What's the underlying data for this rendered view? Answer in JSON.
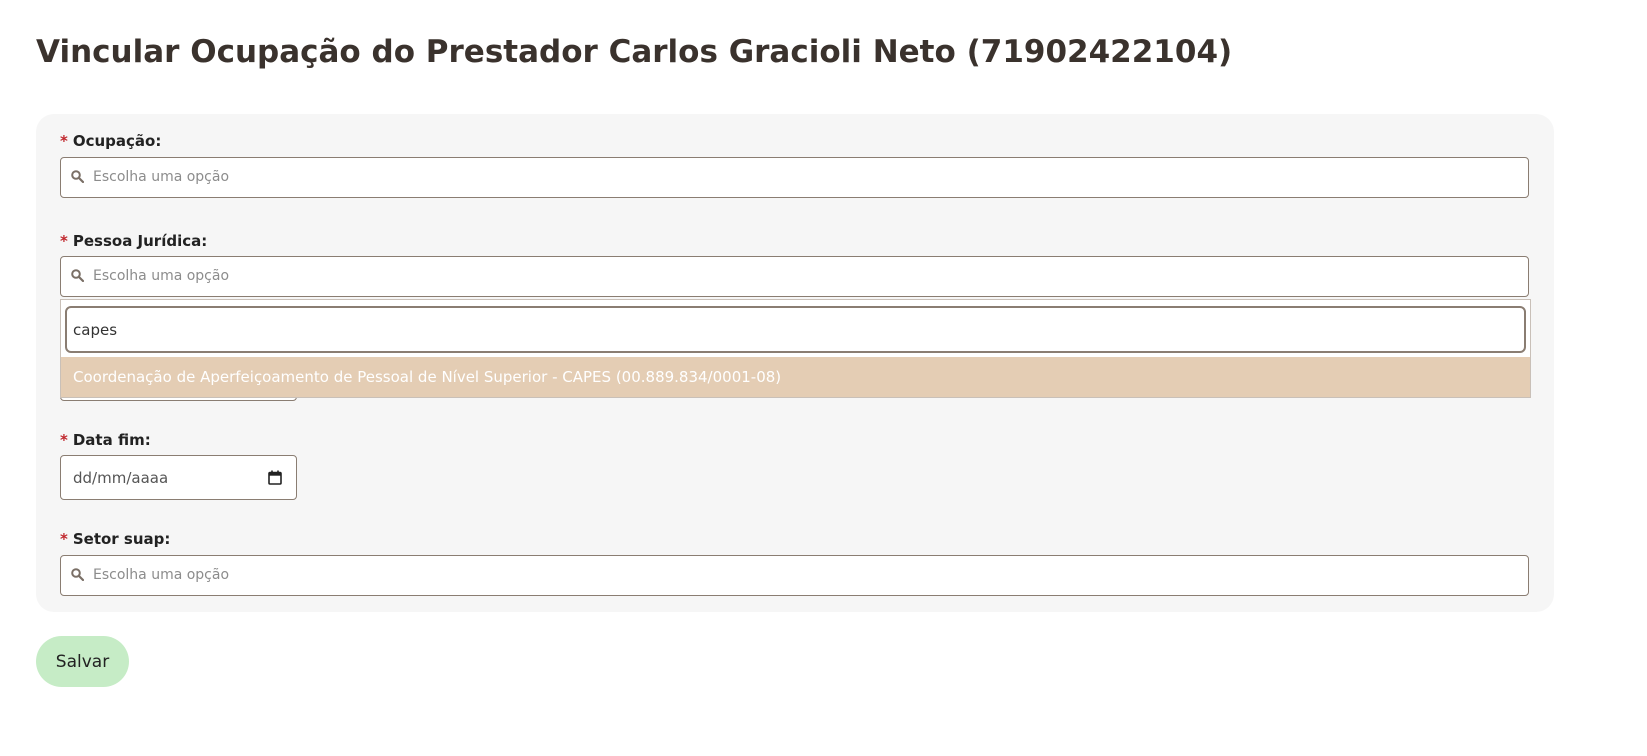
{
  "page": {
    "title": "Vincular Ocupação do Prestador Carlos Gracioli Neto (71902422104)"
  },
  "form": {
    "required_marker": "*",
    "ocupacao": {
      "label": "Ocupação:",
      "placeholder": "Escolha uma opção"
    },
    "pessoa_juridica": {
      "label": "Pessoa Jurídica:",
      "placeholder": "Escolha uma opção",
      "search_value": "capes",
      "options": [
        "Coordenação de Aperfeiçoamento de Pessoal de Nível Superior - CAPES (00.889.834/0001-08)"
      ]
    },
    "data_fim": {
      "label": "Data fim:",
      "placeholder": "dd/mm/aaaa"
    },
    "setor_suap": {
      "label": "Setor suap:",
      "placeholder": "Escolha uma opção"
    },
    "save_label": "Salvar"
  },
  "colors": {
    "required": "#c0272d",
    "highlight_option": "#e4cdb4",
    "save_button": "#c6ecc6",
    "panel": "#f6f6f6"
  },
  "icons": {
    "select": "search-icon",
    "date": "calendar-icon"
  }
}
